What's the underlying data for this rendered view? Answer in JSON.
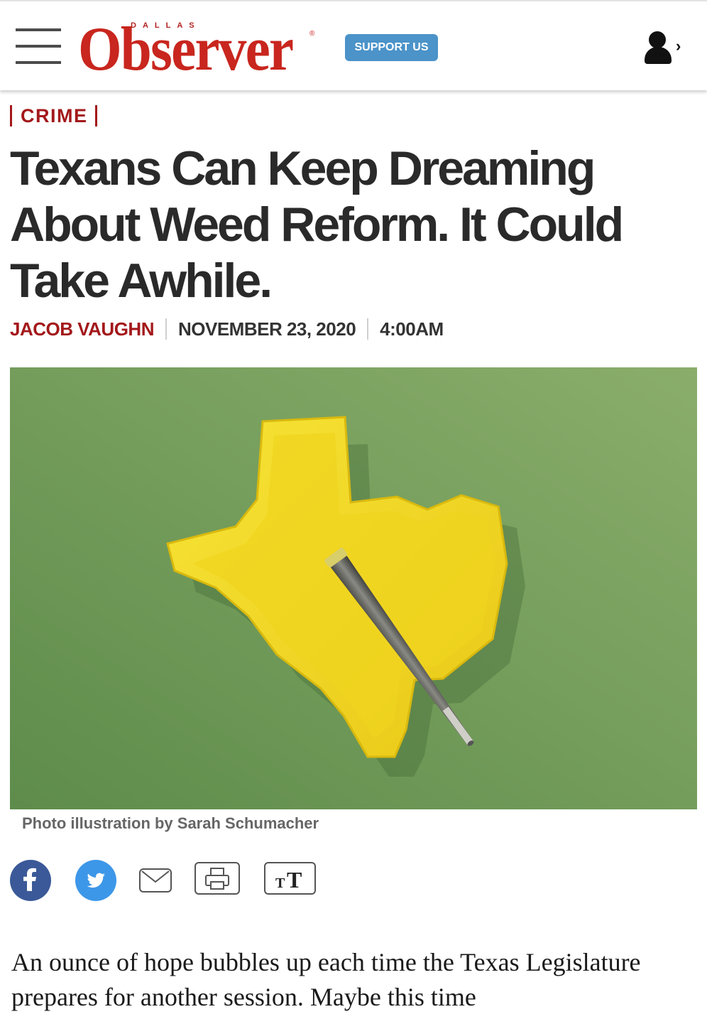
{
  "header": {
    "logo_small": "DALLAS",
    "logo_main": "Observer",
    "logo_reg": "®",
    "support_label": "SUPPORT US",
    "menu_icon": "hamburger-menu-icon",
    "account_icon": "user-account-icon"
  },
  "article": {
    "category": "CRIME",
    "headline": "Texans Can Keep Dreaming About Weed Reform. It Could Take Awhile.",
    "author": "JACOB VAUGHN",
    "date": "NOVEMBER 23, 2020",
    "time": "4:00AM",
    "image_caption": "Photo illustration by Sarah Schumacher",
    "body_first": "An ounce of hope bubbles up each time the Texas Legislature prepares for another session. Maybe this time"
  },
  "share": {
    "facebook_icon": "facebook-icon",
    "twitter_icon": "twitter-icon",
    "email_icon": "email-icon",
    "print_icon": "print-icon",
    "text_size_icon": "text-size-icon"
  },
  "colors": {
    "brand_red": "#c8261e",
    "category_red": "#a3181b",
    "support_blue": "#4b93c9",
    "facebook_blue": "#3b5998",
    "twitter_blue": "#3d97e8",
    "image_green": "#6f9a5c",
    "texas_yellow": "#f2d81f"
  }
}
